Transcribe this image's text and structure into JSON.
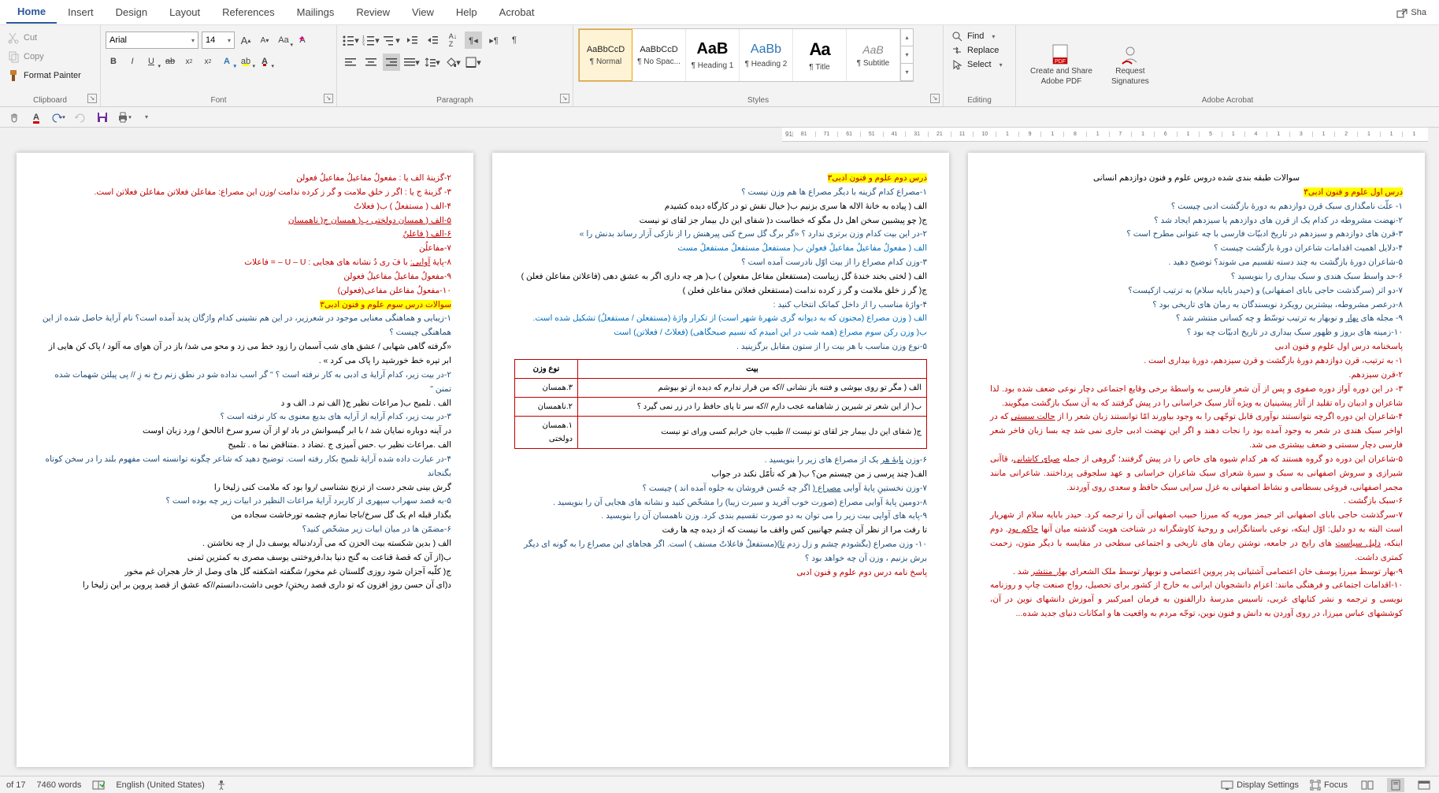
{
  "tabs": {
    "items": [
      "Home",
      "Insert",
      "Design",
      "Layout",
      "References",
      "Mailings",
      "Review",
      "View",
      "Help",
      "Acrobat"
    ],
    "active": 0,
    "share": "Sha"
  },
  "clipboard": {
    "label": "Clipboard",
    "cut": "Cut",
    "copy": "Copy",
    "painter": "Format Painter"
  },
  "font": {
    "label": "Font",
    "name": "Arial",
    "size": "14"
  },
  "paragraph": {
    "label": "Paragraph"
  },
  "styles": {
    "label": "Styles",
    "items": [
      {
        "preview": "AaBbCcD",
        "name": "¶ Normal",
        "sel": true,
        "cls": ""
      },
      {
        "preview": "AaBbCcD",
        "name": "¶ No Spac...",
        "sel": false,
        "cls": ""
      },
      {
        "preview": "AaB",
        "name": "¶ Heading 1",
        "sel": false,
        "cls": "aa",
        "size": "20px"
      },
      {
        "preview": "AaBb",
        "name": "¶ Heading 2",
        "sel": false,
        "cls": "h",
        "size": "16px"
      },
      {
        "preview": "Aa",
        "name": "¶ Title",
        "sel": false,
        "cls": "aa",
        "size": "22px"
      },
      {
        "preview": "AaB",
        "name": "¶ Subtitle",
        "sel": false,
        "cls": "",
        "size": "14px",
        "grey": true
      }
    ]
  },
  "editing": {
    "label": "Editing",
    "find": "Find",
    "replace": "Replace",
    "select": "Select"
  },
  "acrobat": {
    "label": "Adobe Acrobat",
    "create1": "Create and Share",
    "create2": "Adobe PDF",
    "req1": "Request",
    "req2": "Signatures"
  },
  "ruler": [
    "91",
    "81",
    "71",
    "61",
    "51",
    "41",
    "31",
    "21",
    "11",
    "10",
    "1",
    "9",
    "1",
    "8",
    "1",
    "7",
    "1",
    "6",
    "1",
    "5",
    "1",
    "4",
    "1",
    "3",
    "1",
    "2",
    "1",
    "1",
    "1"
  ],
  "status": {
    "page": "of 17",
    "words": "7460 words",
    "lang": "English (United States)",
    "display": "Display Settings",
    "focus": "Focus"
  },
  "doc": {
    "p1": {
      "header": "سوالات طبقه بندی شده دروس علوم و فنون دوازدهم انسانی",
      "title_hl": "درس اول علوم و فنون ادبی۳",
      "q1": "۱- علّت نامگذاری سبک قرن دوازدهم به دورۀ بازگشت ادبی چیست ؟",
      "q2": "۲-نهضت مشروطه در کدام یک از قرن های دوازدهم یا سیزدهم ایجاد شد ؟",
      "q3": "۳-قرن های دوازدهم و سیزدهم در تاریخ ادبیّات فارسی با چه عنوانی مطرح است ؟",
      "q4": "۴-دلایل اهمیت اقدامات شاعران دورۀ بازگشت چیست ؟",
      "q5": "۵-شاعران دورۀ بازگشت به چند دسته تقسیم می شوند؟ توضیح دهید .",
      "q6": "۶-حد واسط سبک هندی و سبک بیداری را بنویسید ؟",
      "q7": "۷-دو اثر (سرگذشت حاجی بابای اصفهانی) و (حیدر بابایه سلام) به ترتیب ازکیست؟",
      "q8": "۸-درعصر مشروطه، بیشترین رویکرد نویسندگان به رمان های تاریخی بود ؟",
      "q9_a": "۹- مجله های ",
      "q9_b": "بهار",
      "q9_c": " و نوبهار به ترتیب توسّط و چه کسانی منتشر شد ؟",
      "q10": "۱۰-زمینه های بروز و ظهور سبک بیداری در تاریخ ادبیّات چه بود ؟",
      "ans_hdr": "پاسخنامه درس اول علوم و فنون ادبی",
      "a1": "۱- به ترتیب، قرن دوازدهم دورۀ بازگشت و قرن سیزدهم، دورۀ بیداری است .",
      "a2": "۲-قرن سیزدهم.",
      "a3": "۳- در این دوره آواز دوره صفوی و پس از آن شعر فارسی به واسطۀ برخی وقایع اجتماعی دچار نوعی ضعف شده بود. لذا شاعران و ادیبان راه تقلید از آثار پیشینیان به ویژه آثار سبک خراسانی را در پیش گرفتند که به آن سبک بازگشت میگویند.",
      "a4_a": "۴-شاعران این دوره اگرچه نتوانستند نوآوری قابل توجّهی را به وجود بیاورند امّا توانستند زبان شعر را از ",
      "a4_b": "حالت سستی",
      "a4_c": " که در اواخر سبک هندی در شعر به وجود آمده بود را نجات دهند و اگر این نهضت ادبی جاری نمی شد چه بسا زبان فاخر شعر فارسی دچار سستی و ضعف بیشتری می شد.",
      "a5_a": "۵-شاعران این دوره دو گروه هستند که هر کدام شیوه های خاص را در پیش گرفتند؛ گروهی از جمله ",
      "a5_b": "صبای کاشانی",
      "a5_c": "، قاآنی شیرازی و سروش اصفهانی به سبک و سیرۀ شعرای سبک شاعران خراسانی و عهد سلجوقی پرداختند. شاعرانی مانند مجمر اصفهانی، فروغی بسطامی و نشاط اصفهانی به غزل سرایی سبک حافظ و سعدی روی آوردند.",
      "a6": "۶-سبک بازگشت .",
      "a7_a": "۷-سرگذشت حاجی بابای اصفهانی اثر جیمز موریه که میرزا حبیب اصفهانی آن را ترجمه کرد. حیدر بابایه سلام از شهریار است البته به دو دلیل: اوّل اینکه، نوعی باستانگرایی و روحیۀ کاوشگرانه در شناخت هویت گذشته میان آنها ",
      "a7_b": "حاکم بود",
      "a7_c": ". دوم اینکه، ",
      "a7_d": "دلیل سیاست",
      "a7_e": " های رایج در جامعه، نوشتن رمان های تاریخی و اجتماعی سطحی در مقایسه با دیگر متون، زحمت کمتری داشت.",
      "a9_a": "۹-بهار توسط میرزا یوسف خان اعتصامی آشتیانی پدر پروین اعتصامی و نوبهار توسط ملک الشعرای ",
      "a9_b": "بهار منتشر",
      "a9_c": " شد .",
      "a10": "۱۰-اقدامات اجتماعی و فرهنگی مانند: اعزام دانشجویان ایرانی به خارج از کشور برای تحصیل، رواج صنعت چاپ و روزنامه نویسی و ترجمه و نشر کتابهای غربی، تاسیس مدرسۀ دارالفنون به فرمان امیرکبیر و آموزش دانشهای نوین در آن، کوششهای عباس میرزا، در روی آوردن به دانش و فنون نوین، توجّه مردم به واقعیت ها و امکانات دنیای جدید شده..."
    },
    "p2": {
      "title_hl": "درس دوم علوم و فنون ادبی۳",
      "q1": "۱-مصراع کدام گزینه با دیگر مصراع ها هم وزن نیست ؟",
      "q1a": "الف ( پیاده به خانۀ الاله ها سری بزنیم       ب( خیال نقش تو در کارگاه دیده کشیدم",
      "q1b": "ج( چو پیشبین سخن اهل دل مگو که خطاست       د( شفای این دل بیمار جز لقای تو نیست",
      "q2": "۲-در این بیت کدام وزن برتری ندارد ؟     «گر برگ گل سرخ کنی پیرهنش را   از نازکی آزار رساند بدنش را »",
      "q2a": "الف ( مفعولُ مفاعیلُ مفاعیلُ فعولن         ب( مستفعلُ مستفعلُ مستفعلُ مست",
      "q3": "۳-وزن کدام مصراع را از بیت اوّل نادرست آمده است ؟",
      "q3a": "الف ( لختی بخند خندۀ گل زیباست (مستفعلن مفاعل مفعولن )       ب( هر چه داری اگر به عشق دهی (فاعلاتن مفاعلن فعلن )",
      "q3b": "ج( گر ز خلق ملامت و گر ز کرده ندامت  (مستفعلن فعلاتن مفاعلن فعلن )",
      "q4": "۴-واژۀ مناسب را از داخل کمانک انتخاب کنید :",
      "q4a": "الف ( وزن مصراع (مجنون که به دیوانه گری شهرۀ شهر است) از تکرار واژۀ (مستفعلن / مستفعلُ) تشکیل شده است.",
      "q4b": "ب(  وزن رکن سوم مصراع (همه شب در این امیدم که نسیم صبحگاهی) (فعلاتُ / فعلاتن) است",
      "q5": "۵-نوع وزن مناسب با هر بیت را از ستون مقابل برگزینید .",
      "tbl": {
        "h1": "بیت",
        "h2": "نوع وزن",
        "r1a": "الف ( مگر تو روی بپوشی و فتنه باز نشانی //که من قرار ندارم که دیده از تو بپوشم",
        "r1b": "۳.همسان",
        "r2a": "ب( از این شعر تر شیرین ز شاهنامه عجب دارم //که سر تا پای حافظ را در زر نمی گیرد ؟",
        "r2b": "۲.ناهمسان",
        "r3a": "ج( شفای این دل بیمار جز لقای تو نیست // طبیب جان خرابم کسی ورای تو نیست",
        "r3b": "۱.همسان دولختی"
      },
      "q6_a": "۶-وزن ",
      "q6_b": "پایۀ هر",
      "q6_c": " یک از مصراع های زیر را بنویسید .",
      "q6a": "الف( چند پرسی ز من چیستم من؟         ب( هر که تأمّل نکند در جواب",
      "q7_a": "۷-وزن نخستینِ پایۀ آوایی ",
      "q7_b": "مصراع (",
      "q7_c": " اگر چه حُسن فروشان به جلوه آمده اند ) چیست ؟",
      "q8": "۸-دومین پایۀ آوایی مصراع (صورت خوب آفرید و سیرت زیبا) را مشخّص کنید و نشانه های هجایی آن را بنویسید .",
      "q9": "۹-پایه های آوایی بیت زیر را می توان به دو صورت تقسیم بندی کرد. وزن ناهمسان آن را بنویسید .",
      "q9a": "تا رفت مرا از نظر آن چشم جهانبین             کس واقف ما نیست که از دیده چه ها رفت",
      "q10_a": "۱۰- وزن مصراع (بگشودم چشم و زل زدم ",
      "q10_b": "تا",
      "q10_c": ")(مستفعلُ فاعلاتُ مستف ) است. اگر هجاهای این مصراع را به گونه ای دیگر برش بزنیم ، وزن آن چه خواهد بود ؟",
      "ans_hdr": "پاسخ نامه درس دوم علوم و فنون ادبی"
    },
    "p3": {
      "l1": "۲-گزینۀ الف یا : مفعولُ مفاعیلُ مفاعیلُ فعولن",
      "l2": "۳- گزینۀ ج یا : اگر ز خلق ملامت و گر ز کرده ندامت /وزن این مصراع: مفاعلن فعلاتن مفاعلن فعلاتن است.",
      "l3a": "۴-الف ( مستفعلُ  )     ب( فعلاتُ",
      "l4": "۵-الف ( همسان دولختی       ب( همسان       ج( ناهمسان",
      "l5": "۶-الف ( فاعلنُ",
      "l6": "۷-مفاعلُن",
      "l7_a": "۸-پایۀ ",
      "l7_b": "آوایی:",
      "l7_c": "   با فَ ری دُ           نشانه های هجایی :   U – U –  =  فاعلات",
      "l8": "۹-مفعولُ مفاعیلُ مفاعیلُ فعولن",
      "l9": "۱۰-مفعولُ مفاعلن مفاعی(فعولن)",
      "title_hl": "سوالات درس سوم علوم و فنون ادبی۳",
      "q1": "۱-زیبایی و هماهنگی معنایی موجود در شعرزیر، در این هم نشینی کدام واژگان پدید آمده است؟ نام آرایۀ حاصل شده از این هماهنگی چیست ؟",
      "q1a": "«گرفته گاهی شهابی / عشق های شب آسمان را زود خط می زد و محو می شد/ باز در آن هوای مه آلود / پاک کن هایی از ابر تیره خط خورشید را پاک می کرد » .",
      "q2": "۲-در بیت زیر، کدام آرایۀ ی ادبی به کار نرفته است ؟  \" گر اسب نداده شو در نطق زنم رخ نه زِ // پی پیلتن شهمات شده تمنن \"",
      "q2a": "الف . تلمیح        ب( مراعات نظیر        ج( الف تم        د. الف و د",
      "q3": "۳-در بیت زیر، کدام آرایه از آرایه های بدیع معنوی به کار نرفته است ؟",
      "q3a": "در آینه دوباره نمایان شد / با ابر گیسوانش در باد /و از آن سرو سرخ اتالحق / ورد زبان اوست",
      "q3b": "الف .مراعات نظیر       ب .حس آمیزی       ج .تضاد       د .متناقض نما       ه . تلمیح",
      "q4": "۴-در عبارت داده شده آرایۀ تلمیح بکار رفته است. توضیح دهید که شاعر چگونه توانسته است مفهوم بلند را در سخن کوتاه بگنجاند",
      "q4a": "گرش بینی شجر دست از ترنج نشناسی /روا بود که ملامت کنی زلیخا را",
      "q5": "۵-به قصد سهراب سپهری از کاربرد آرایۀ مراعات النظیر در ابیات زیر چه بوده است ؟",
      "q5a": "بگذار قبله ام یک گل سرخ/باجا نمازم چشمه تورخاشت سجاده من",
      "q6": "۶-مضمّن ها در میان ابیات زیر مشخّص کنید؟",
      "q6a": "الف ( بدین شکسته بیت الحزن که می آرد/دنباله یوسف دل از چه نخاشتن .",
      "q6b": "ب(از آن که قصۀ قناعت به گنج دنیا بدا،فروختنی یوسف مصری به کمترین ثمنی",
      "q6c": "ج( کلّبه آجزان شود روزی گلستان غم مخور/ شگفته اشکفته گل های وصل از خار هجران غم مخور",
      "q6d": "د(ای آن حسن روزِ افزون که تو داری قصد ریختنِ/ خوبی داشت،دانستم//که عشق از قصد پروین بر این زلیخا را"
    }
  }
}
